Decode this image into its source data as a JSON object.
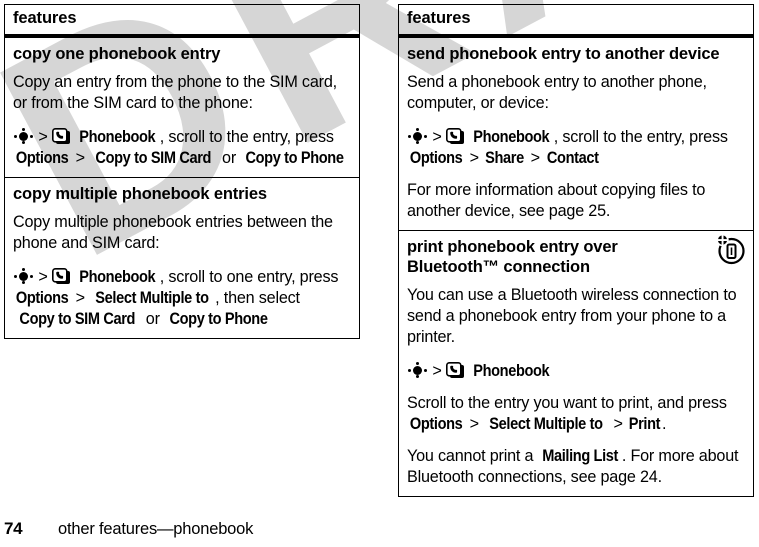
{
  "watermark": {
    "text": "DRAFT"
  },
  "footer": {
    "page_number": "74",
    "breadcrumb": "other features—phonebook"
  },
  "left_column": {
    "header": "features",
    "sections": [
      {
        "title": "copy one phonebook entry",
        "paragraphs": [
          "Copy an entry from the phone to the SIM card, or from the SIM card to the phone:"
        ],
        "step": {
          "navkey_icon": "navigation-key-icon",
          "sep1": ">",
          "phonebook_icon": "phonebook-icon",
          "ui1": "Phonebook",
          "mid1": ", scroll to the entry, press ",
          "ui2": "Options",
          "sep2": ">",
          "ui3": "Copy to SIM Card",
          "mid2": " or ",
          "ui4": "Copy to Phone"
        }
      },
      {
        "title": "copy multiple phonebook entries",
        "paragraphs": [
          "Copy multiple phonebook entries between the phone and SIM card:"
        ],
        "step": {
          "navkey_icon": "navigation-key-icon",
          "sep1": ">",
          "phonebook_icon": "phonebook-icon",
          "ui1": "Phonebook",
          "mid1": ", scroll to one entry, press ",
          "ui2": "Options",
          "sep2": ">",
          "ui3": "Select Multiple to",
          "mid2": ", then select ",
          "ui4": "Copy to SIM Card",
          "mid3": " or ",
          "ui5": "Copy to Phone"
        }
      }
    ]
  },
  "right_column": {
    "header": "features",
    "sections": [
      {
        "title": "send phonebook entry to another device",
        "paragraphs": [
          "Send a phonebook entry to another phone, computer, or device:"
        ],
        "step": {
          "navkey_icon": "navigation-key-icon",
          "sep1": ">",
          "phonebook_icon": "phonebook-icon",
          "ui1": "Phonebook",
          "mid1": ", scroll to the entry, press ",
          "ui2": "Options",
          "sep2": ">",
          "ui3": "Share",
          "sep3": ">",
          "ui4": "Contact"
        },
        "after": "For more information about copying files to another device, see page 25."
      },
      {
        "title": "print phonebook entry over Bluetooth™ connection",
        "corner_icon": "bluetooth-print-phone-icon",
        "paragraphs": [
          "You can use a Bluetooth wireless connection to send a phonebook entry from your phone to a printer."
        ],
        "step": {
          "navkey_icon": "navigation-key-icon",
          "sep1": ">",
          "phonebook_icon": "phonebook-icon",
          "ui1": "Phonebook"
        },
        "after_a_pre": "Scroll to the entry you want to print, and press ",
        "after_a_ui1": "Options",
        "after_a_sep1": ">",
        "after_a_ui2": "Select Multiple to",
        "after_a_sep2": ">",
        "after_a_ui3": "Print",
        "after_a_post": ".",
        "after_b_pre": "You cannot print a ",
        "after_b_ui1": "Mailing List",
        "after_b_post": ". For more about Bluetooth connections, see page 24."
      }
    ]
  }
}
